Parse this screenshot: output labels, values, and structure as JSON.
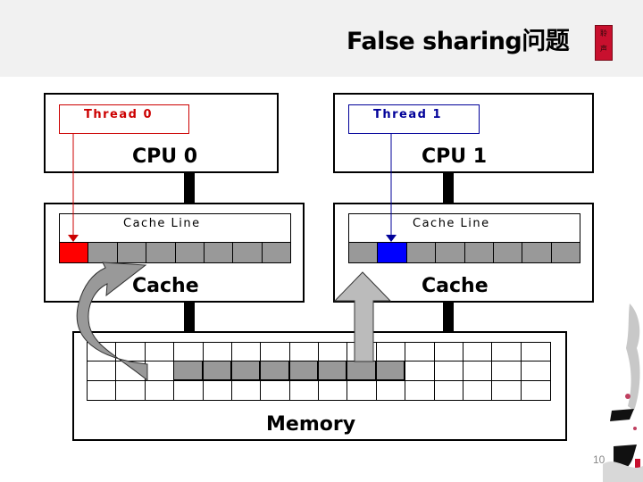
{
  "slide": {
    "title": "False sharing问题",
    "seal_text": [
      "聆",
      "声"
    ],
    "page_number": "10"
  },
  "diagram": {
    "cpus": [
      {
        "name": "CPU 0",
        "thread": "Thread 0",
        "thread_color": "#cc0000",
        "cache_label": "Cache",
        "cache_line_label": "Cache Line",
        "highlight_index": 0,
        "highlight_color": "#ff0000"
      },
      {
        "name": "CPU 1",
        "thread": "Thread 1",
        "thread_color": "#000099",
        "cache_label": "Cache",
        "cache_line_label": "Cache Line",
        "highlight_index": 1,
        "highlight_color": "#0000ff"
      }
    ],
    "cache_line_cells": 8,
    "memory": {
      "label": "Memory",
      "columns": 16,
      "rows": 3,
      "cache_line_row": 1,
      "cache_line_start_col": 3,
      "cache_line_length": 8
    },
    "colors": {
      "cell_gray": "#999999",
      "arrow_gray": "#bbbbbb",
      "header_bg": "#f1f1f1"
    }
  }
}
